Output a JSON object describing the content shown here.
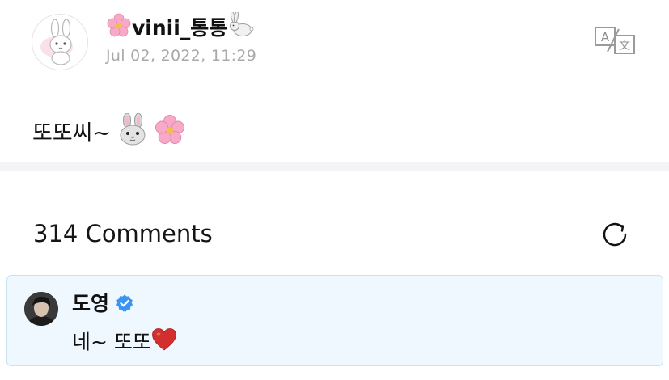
{
  "post": {
    "author_name": "vinii_통통",
    "date": "Jul 02, 2022, 11:29",
    "body_text": "또또씨~",
    "author_prefix_icon": "cherry-blossom-icon",
    "author_suffix_icon": "rabbit-icon",
    "body_icons": [
      "rabbit-face-icon",
      "cherry-blossom-icon"
    ],
    "translate_icon": "translate-icon"
  },
  "comments": {
    "count_label": "314 Comments",
    "refresh_icon": "refresh-icon",
    "items": [
      {
        "author": "도영",
        "verified": true,
        "text": "네~ 또또",
        "text_icon": "red-heart-icon"
      }
    ]
  },
  "colors": {
    "highlight_bg": "#eef8fe",
    "highlight_border": "#c8e2f0",
    "verified": "#3b95f0",
    "date_text": "#a9a9a9",
    "heart": "#d32f2f",
    "blossom": "#f7a9c8"
  }
}
